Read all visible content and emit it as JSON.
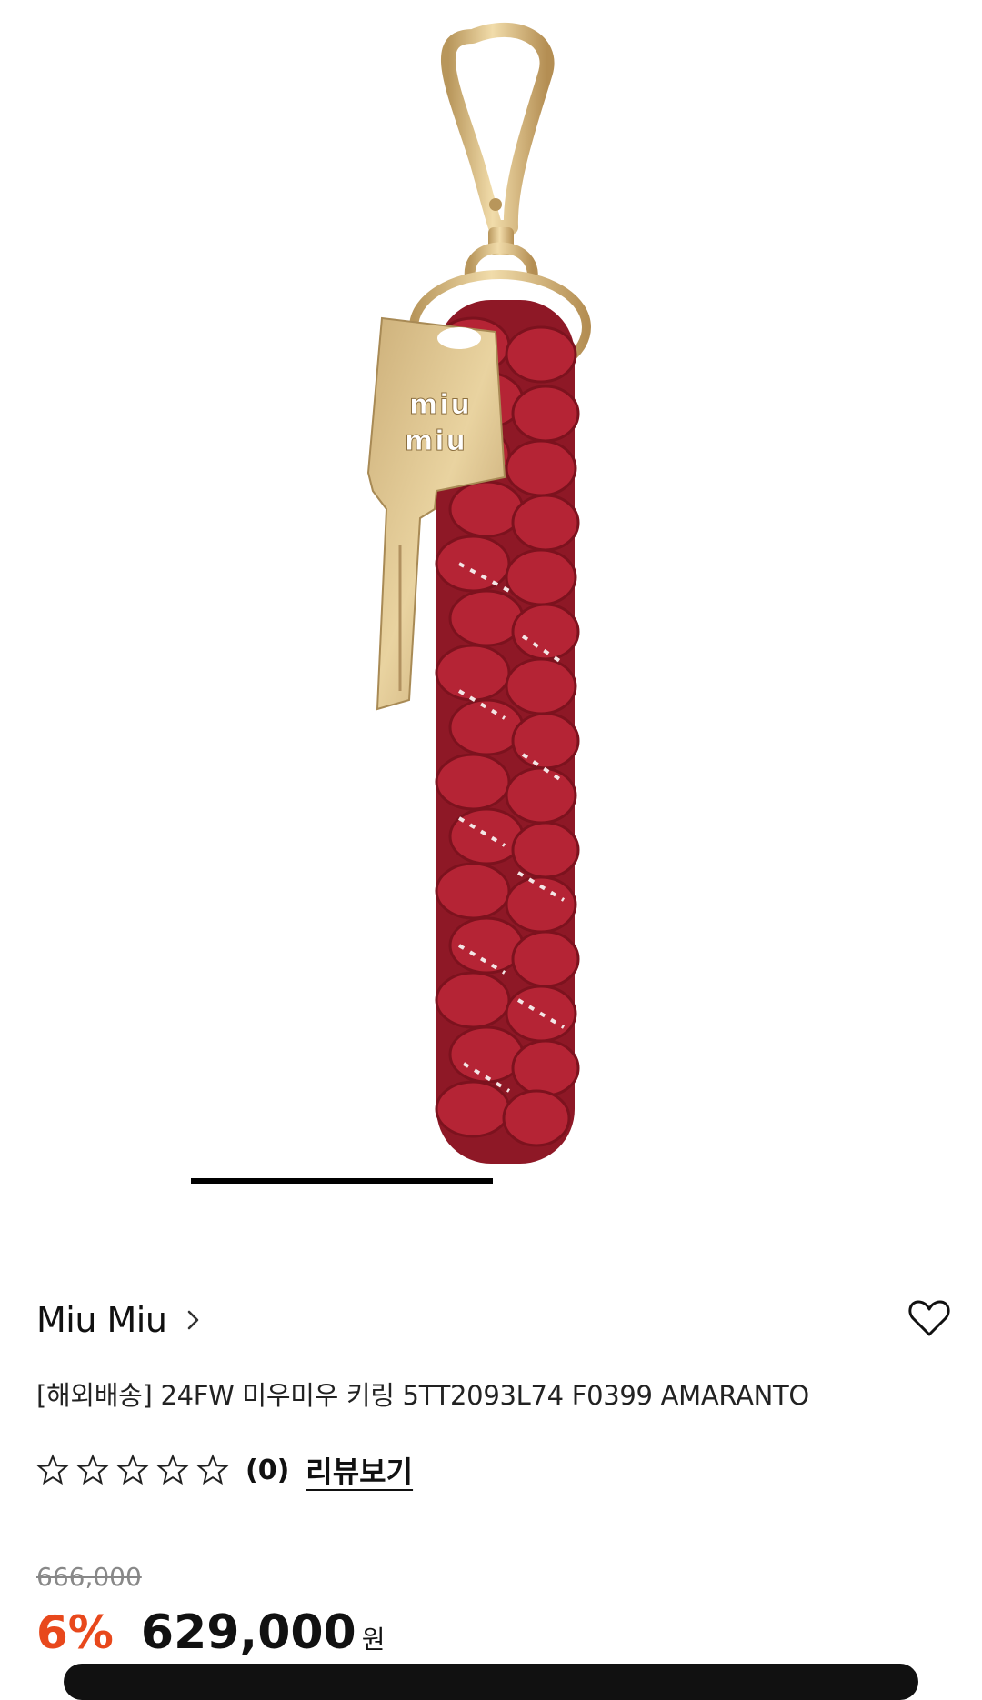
{
  "product": {
    "brand": "Miu Miu",
    "title": "[해외배송] 24FW 미우미우 키링 5TT2093L74 F0399 AMARANTO",
    "rating": 0,
    "rating_max": 5,
    "review_count": "(0)",
    "review_link_label": "리뷰보기",
    "original_price": "666,000",
    "discount": "6%",
    "price": "629,000",
    "currency": "원"
  },
  "gallery": {
    "image_alt": "Miu Miu braided keyring with gold key charm",
    "key_engraving": "miu miu",
    "active_slide": 1
  },
  "colors": {
    "accent_discount": "#e8481c",
    "cord_red": "#a51d2d",
    "gold": "#d8b77e"
  },
  "icons": {
    "chevron": "chevron-right-icon",
    "wish": "heart-icon",
    "star": "star-outline-icon"
  }
}
